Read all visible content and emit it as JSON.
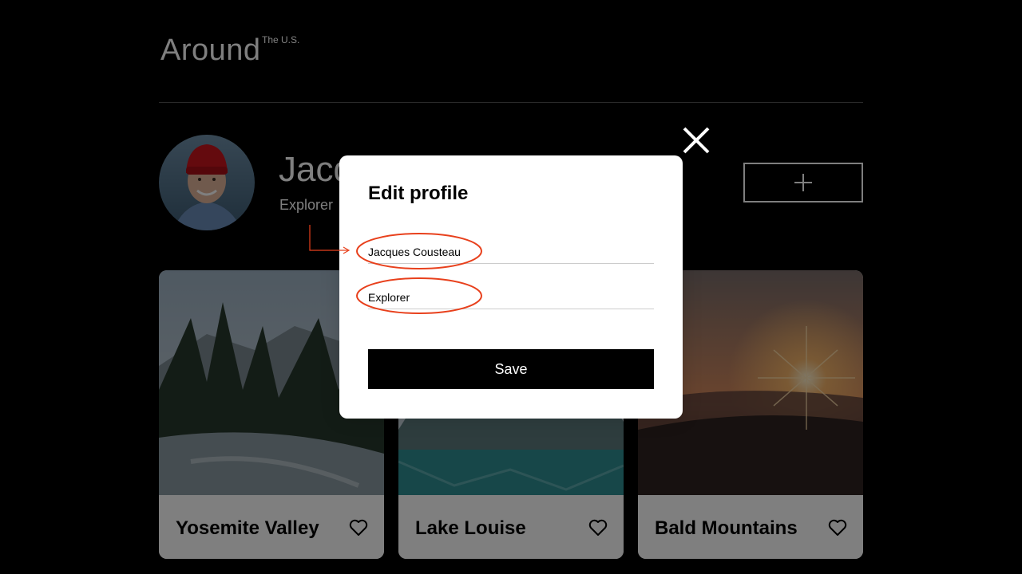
{
  "header": {
    "logo": "Around",
    "logo_sup": "The U.S."
  },
  "profile": {
    "name": "Jacques Cousteau",
    "job": "Explorer"
  },
  "add_button": {
    "icon": "plus-icon"
  },
  "cards": [
    {
      "title": "Yosemite Valley",
      "icon": "heart-icon"
    },
    {
      "title": "Lake Louise",
      "icon": "heart-icon"
    },
    {
      "title": "Bald Mountains",
      "icon": "heart-icon"
    }
  ],
  "modal": {
    "title": "Edit profile",
    "name_value": "Jacques Cousteau",
    "job_value": "Explorer",
    "save_label": "Save",
    "close_icon": "close-icon"
  },
  "annotation": {
    "color": "#e8401c"
  }
}
